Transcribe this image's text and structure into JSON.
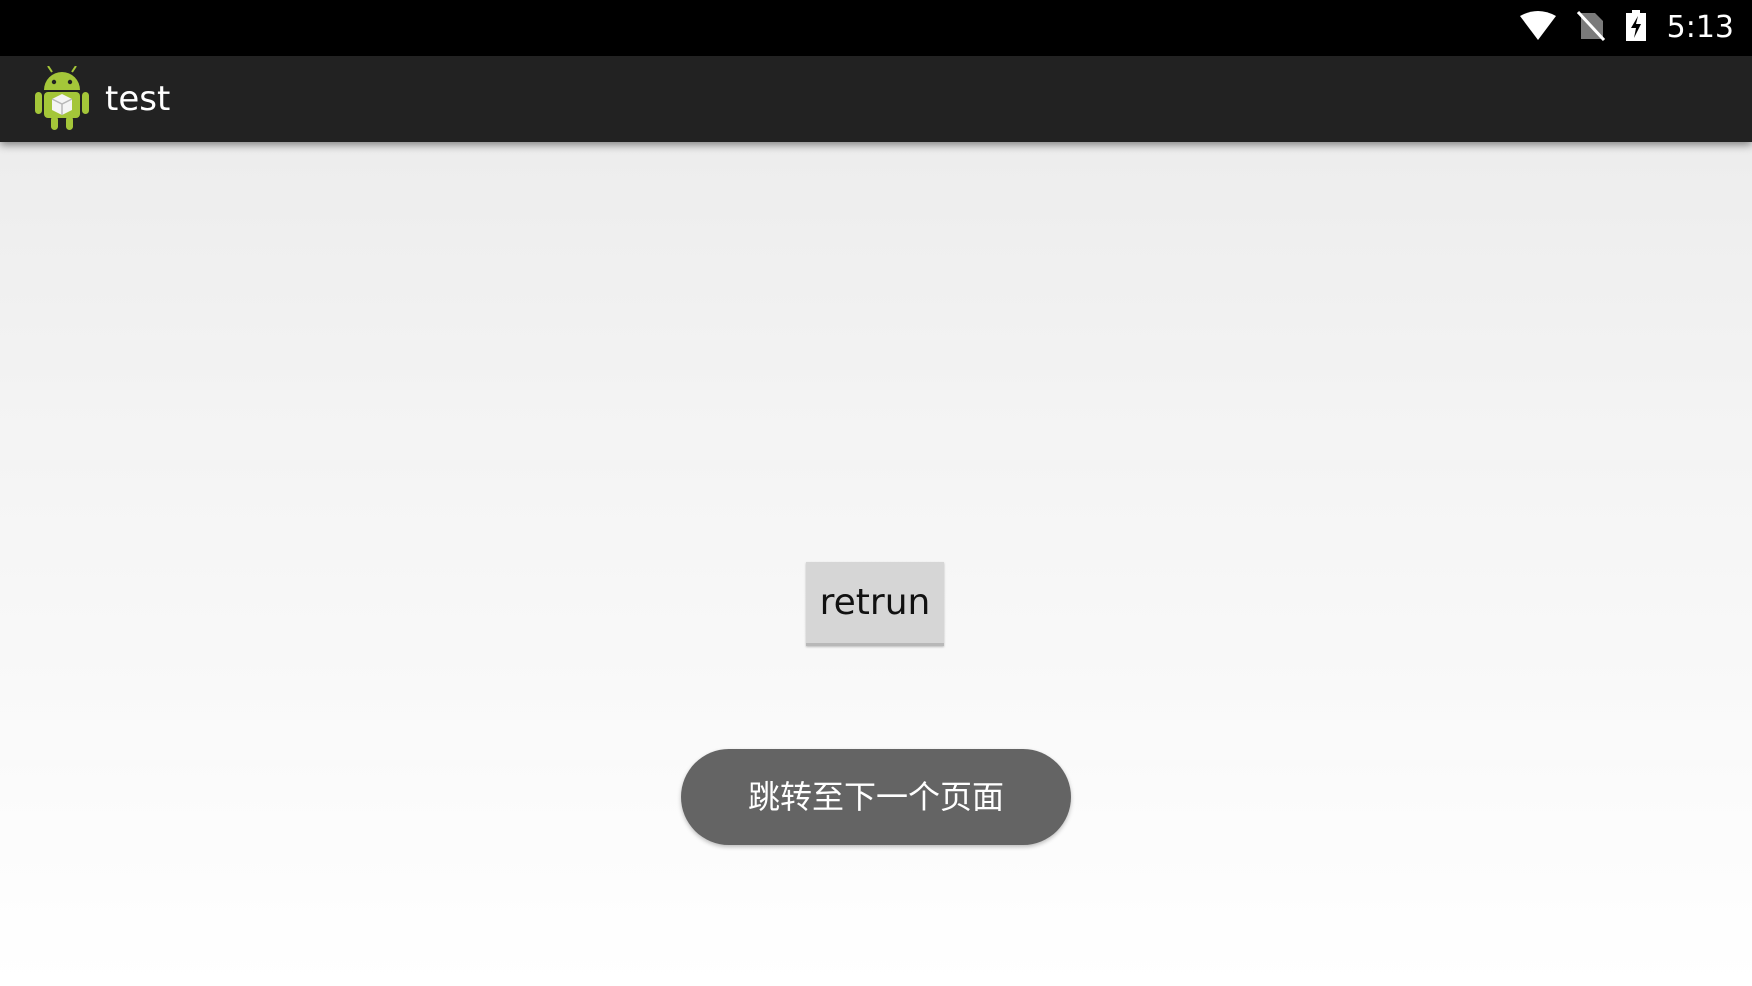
{
  "status_bar": {
    "time": "5:13",
    "icons": [
      "wifi-icon",
      "no-sim-icon",
      "battery-charging-icon"
    ],
    "background": "#000000"
  },
  "action_bar": {
    "title": "test",
    "icon": "android-app-icon",
    "background": "#222222"
  },
  "main": {
    "return_button_label": "retrun",
    "button_background": "#d6d6d6"
  },
  "toast": {
    "message": "跳转至下一个页面",
    "background": "#646464"
  }
}
